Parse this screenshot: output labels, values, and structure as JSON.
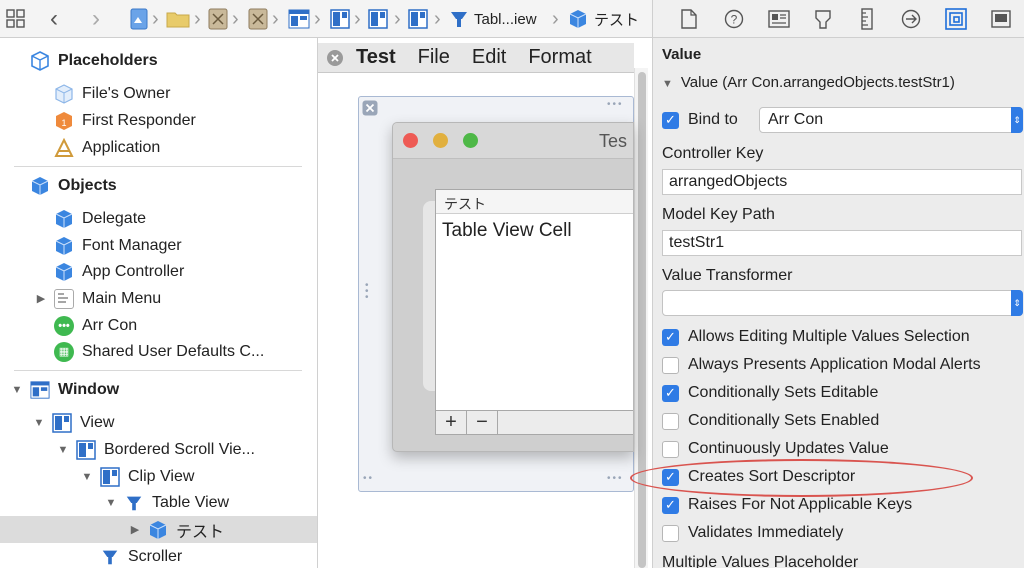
{
  "jumpbar": {
    "crumbs": [
      "Tabl...iew",
      "テスト"
    ]
  },
  "inspector_toolbar": {
    "icons": [
      "file-icon",
      "help-icon",
      "identity-icon",
      "attributes-icon",
      "size-icon",
      "connections-icon",
      "bindings-icon",
      "effects-icon"
    ]
  },
  "outline": {
    "placeholders_label": "Placeholders",
    "files_owner": "File's Owner",
    "first_responder": "First Responder",
    "application": "Application",
    "objects_label": "Objects",
    "delegate": "Delegate",
    "font_manager": "Font Manager",
    "app_controller": "App Controller",
    "main_menu": "Main Menu",
    "arr_con": "Arr Con",
    "shared_defaults": "Shared User Defaults C...",
    "window": "Window",
    "view": "View",
    "bordered_scroll_view": "Bordered Scroll Vie...",
    "clip_view": "Clip View",
    "table_view": "Table View",
    "test_column": "テスト",
    "scroller": "Scroller"
  },
  "canvas": {
    "menu": [
      "Test",
      "File",
      "Edit",
      "Format"
    ],
    "window_title": "Tes",
    "column_header": "テスト",
    "cell_text": "Table View Cell",
    "add_button": "+",
    "remove_button": "−"
  },
  "inspector": {
    "section_title": "Value",
    "binding_summary": "Value (Arr Con.arrangedObjects.testStr1)",
    "bind_to_label": "Bind to",
    "bind_to_value": "Arr Con",
    "controller_key_label": "Controller Key",
    "controller_key_value": "arrangedObjects",
    "model_key_path_label": "Model Key Path",
    "model_key_path_value": "testStr1",
    "value_transformer_label": "Value Transformer",
    "value_transformer_value": "",
    "options": [
      {
        "label": "Allows Editing Multiple Values Selection",
        "checked": true
      },
      {
        "label": "Always Presents Application Modal Alerts",
        "checked": false
      },
      {
        "label": "Conditionally Sets Editable",
        "checked": true
      },
      {
        "label": "Conditionally Sets Enabled",
        "checked": false
      },
      {
        "label": "Continuously Updates Value",
        "checked": false
      },
      {
        "label": "Creates Sort Descriptor",
        "checked": true
      },
      {
        "label": "Raises For Not Applicable Keys",
        "checked": true
      },
      {
        "label": "Validates Immediately",
        "checked": false
      }
    ],
    "multiple_values_placeholder_label": "Multiple Values Placeholder"
  },
  "colors": {
    "accent": "#2f7be5",
    "annotation": "#d9544f"
  }
}
